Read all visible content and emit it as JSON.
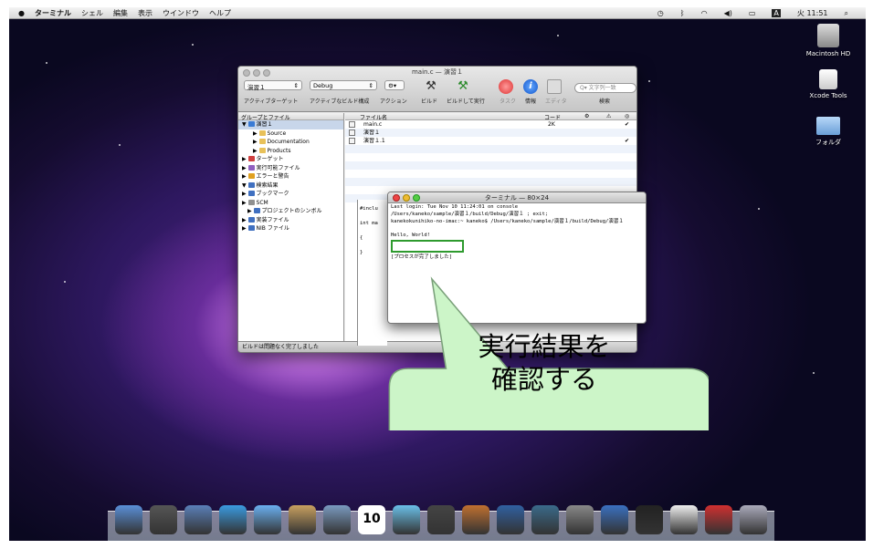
{
  "menubar": {
    "apple": "",
    "items": [
      "ターミナル",
      "シェル",
      "編集",
      "表示",
      "ウインドウ",
      "ヘルプ"
    ],
    "status": {
      "input": "A",
      "clock": "火 11:51"
    }
  },
  "desktop": {
    "icons": [
      {
        "label": "Macintosh HD",
        "icon": "hard-drive-icon"
      },
      {
        "label": "Xcode Tools",
        "icon": "disk-icon"
      },
      {
        "label": "フォルダ",
        "icon": "folder-icon"
      }
    ]
  },
  "xcode": {
    "title": "main.c — 演習１",
    "target_select": "演習１",
    "config_select": "Debug",
    "toolbar_labels": {
      "target": "アクティブターゲット",
      "config": "アクティブなビルド構成",
      "action": "アクション",
      "build": "ビルド",
      "build_run": "ビルドして実行",
      "tasks": "タスク",
      "info": "情報",
      "editor": "エディタ",
      "search": "検索"
    },
    "search_placeholder": "Q▾ 文字列一致",
    "sidebar_header": "グループとファイル",
    "sidebar": [
      {
        "label": "演習１",
        "indent": 0,
        "color": "#3a7bd5",
        "selected": true
      },
      {
        "label": "Source",
        "indent": 2,
        "color": "#e8c15a"
      },
      {
        "label": "Documentation",
        "indent": 2,
        "color": "#e8c15a"
      },
      {
        "label": "Products",
        "indent": 2,
        "color": "#e8c15a"
      },
      {
        "label": "ターゲット",
        "indent": 0,
        "color": "#d04040"
      },
      {
        "label": "実行可能ファイル",
        "indent": 0,
        "color": "#9060c0"
      },
      {
        "label": "エラーと警告",
        "indent": 0,
        "color": "#e0a020"
      },
      {
        "label": "検索結果",
        "indent": 0,
        "color": "#4070c0"
      },
      {
        "label": "ブックマーク",
        "indent": 0,
        "color": "#4070c0"
      },
      {
        "label": "SCM",
        "indent": 0,
        "color": "#909090"
      },
      {
        "label": "プロジェクトのシンボル",
        "indent": 1,
        "color": "#4070c0"
      },
      {
        "label": "実装ファイル",
        "indent": 0,
        "color": "#4070c0"
      },
      {
        "label": "NIB ファイル",
        "indent": 0,
        "color": "#4070c0"
      }
    ],
    "file_headers": {
      "name": "ファイル名",
      "code": "コード"
    },
    "files": [
      {
        "name": "main.c",
        "code": "2K",
        "check": "✔"
      },
      {
        "name": "演習１",
        "code": "",
        "check": ""
      },
      {
        "name": "演習１.1",
        "code": "",
        "check": "✔"
      }
    ],
    "code_lines": [
      "#inclu",
      "",
      "int ma",
      "",
      "{",
      "",
      "}"
    ],
    "status": "ビルドは問題なく完了しました"
  },
  "terminal": {
    "title": "ターミナル — 80×24",
    "lines": [
      "Last login: Tue Nov 10 11:24:01 on console",
      "/Users/kaneko/sample/演習１/build/Debug/演習１ ; exit;",
      "kanekokunihiko-no-imac:~ kaneko$ /Users/kaneko/sample/演習１/build/Debug/演習１",
      "",
      "Hello, World!",
      "",
      "",
      "[プロセスが完了しました]"
    ]
  },
  "callout": {
    "line1": "実行結果を",
    "line2": "確認する",
    "color": "#ccf5c8"
  },
  "dock": {
    "items": [
      "finder-icon",
      "dashboard-icon",
      "mail-icon",
      "safari-icon",
      "ichat-icon",
      "address-book-icon",
      "iphoto-icon",
      "ical-icon",
      "itunes-icon",
      "imovie-icon",
      "garageband-icon",
      "spaces-icon",
      "time-machine-icon",
      "system-preferences-icon",
      "xcode-icon",
      "terminal-icon",
      "document-icon",
      "filezilla-icon",
      "trash-icon"
    ],
    "ical_day": "10"
  }
}
